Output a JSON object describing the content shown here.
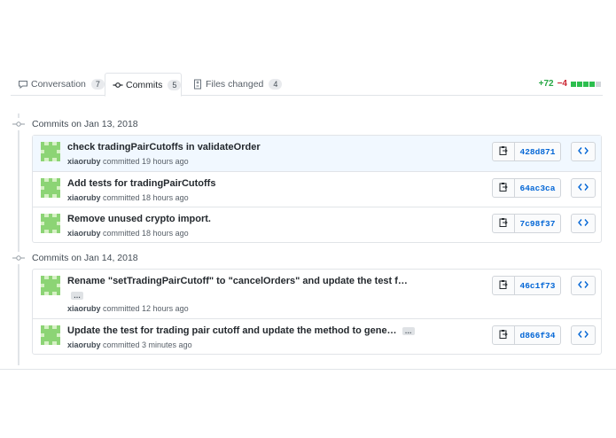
{
  "tabs": [
    {
      "label": "Conversation",
      "count": "7",
      "icon": "comment-icon"
    },
    {
      "label": "Commits",
      "count": "5",
      "icon": "git-commit-icon"
    },
    {
      "label": "Files changed",
      "count": "4",
      "icon": "file-diff-icon"
    }
  ],
  "diffstat": {
    "additions": "+72",
    "deletions": "−4"
  },
  "colors": {
    "added": "#28a745",
    "deleted": "#cb2431",
    "link": "#0366d6",
    "highlight": "#f1f8ff",
    "avatar": "#8cd475"
  },
  "groups": [
    {
      "date_label": "Commits on Jan 13, 2018",
      "commits": [
        {
          "title": "check tradingPairCutoffs in validateOrder",
          "author": "xiaoruby",
          "time": "committed 19 hours ago",
          "sha": "428d871"
        },
        {
          "title": "Add tests for tradingPairCutoffs",
          "author": "xiaoruby",
          "time": "committed 18 hours ago",
          "sha": "64ac3ca"
        },
        {
          "title": "Remove unused crypto import.",
          "author": "xiaoruby",
          "time": "committed 18 hours ago",
          "sha": "7c98f37"
        }
      ]
    },
    {
      "date_label": "Commits on Jan 14, 2018",
      "commits": [
        {
          "title": "Rename \"setTradingPairCutoff\" to \"cancelOrders\" and update the test f…",
          "author": "xiaoruby",
          "time": "committed 12 hours ago",
          "sha": "46c1f73"
        },
        {
          "title": "Update the test for trading pair cutoff and update the method to gene…",
          "author": "xiaoruby",
          "time": "committed 3 minutes ago",
          "sha": "d866f34"
        }
      ]
    }
  ],
  "ellipsis_label": "…"
}
